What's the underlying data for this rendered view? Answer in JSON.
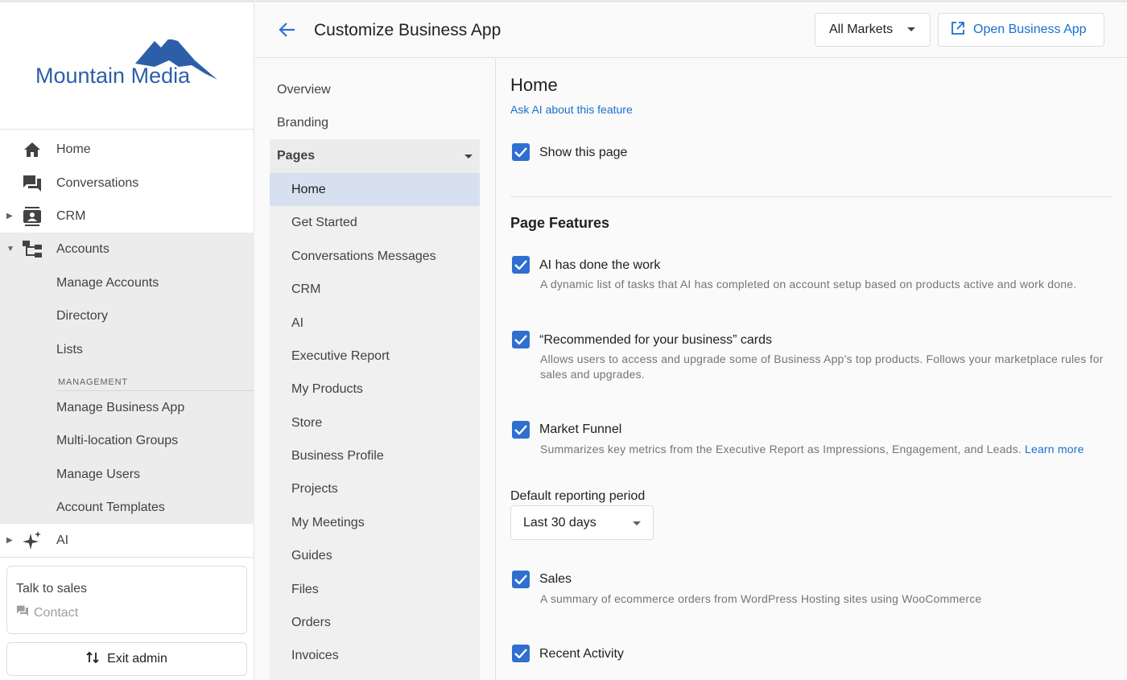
{
  "sidebar": {
    "brand": "Mountain Media",
    "items": [
      {
        "label": "Home",
        "icon": "home-icon"
      },
      {
        "label": "Conversations",
        "icon": "chat-icon"
      },
      {
        "label": "CRM",
        "icon": "contacts-icon"
      },
      {
        "label": "Accounts",
        "icon": "hierarchy-icon"
      },
      {
        "label": "Manage Accounts"
      },
      {
        "label": "Directory"
      },
      {
        "label": "Lists"
      },
      {
        "label": "Manage Business App"
      },
      {
        "label": "Multi-location Groups"
      },
      {
        "label": "Manage Users"
      },
      {
        "label": "Account Templates"
      },
      {
        "label": "AI",
        "icon": "sparkle-icon"
      }
    ],
    "management_label": "MANAGEMENT",
    "sales_box": {
      "title": "Talk to sales",
      "contact": "Contact"
    },
    "exit_label": "Exit admin"
  },
  "header": {
    "title": "Customize Business App",
    "market_select": "All Markets",
    "open_button": "Open Business App"
  },
  "subnav": {
    "top_items": [
      "Overview",
      "Branding"
    ],
    "pages_label": "Pages",
    "pages": [
      "Home",
      "Get Started",
      "Conversations Messages",
      "CRM",
      "AI",
      "Executive Report",
      "My Products",
      "Store",
      "Business Profile",
      "Projects",
      "My Meetings",
      "Guides",
      "Files",
      "Orders",
      "Invoices"
    ],
    "active_page": "Home"
  },
  "content": {
    "title": "Home",
    "ask_ai": "Ask AI about this feature",
    "show_page": "Show this page",
    "features_title": "Page Features",
    "features": [
      {
        "label": "AI has done the work",
        "desc": "A dynamic list of tasks that AI has completed on account setup based on products active and work done.",
        "checked": true
      },
      {
        "label": "“Recommended for your business” cards",
        "desc": "Allows users to access and upgrade some of Business App’s top products. Follows your marketplace rules for sales and upgrades.",
        "checked": true
      },
      {
        "label": "Market Funnel",
        "desc": "Summarizes key metrics from the Executive Report as Impressions, Engagement, and Leads.",
        "link": "Learn more",
        "checked": true
      },
      {
        "label": "Sales",
        "desc": "A summary of ecommerce orders from WordPress Hosting sites using WooCommerce",
        "checked": true
      },
      {
        "label": "Recent Activity",
        "checked": true
      }
    ],
    "period_label": "Default reporting period",
    "period_value": "Last 30 days"
  },
  "colors": {
    "accent": "#2f6fd0",
    "link": "#1a6fd1",
    "active_bg": "#d6e0ef",
    "logo_blue": "#2c5fa8"
  }
}
